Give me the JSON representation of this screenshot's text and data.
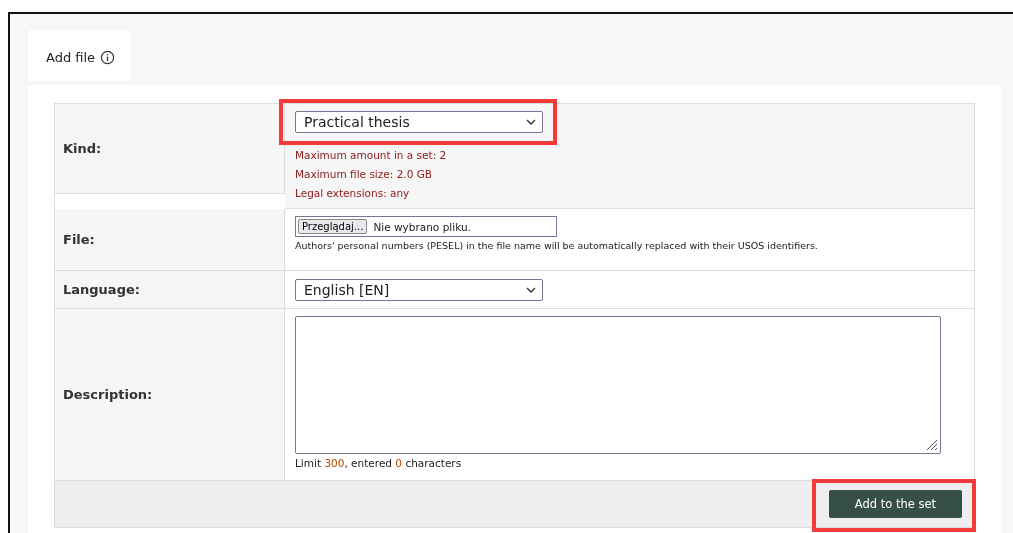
{
  "tabs": [
    {
      "label": "Add file",
      "selected": true
    }
  ],
  "form": {
    "kind": {
      "label": "Kind:",
      "value": "Practical thesis",
      "notes": [
        "Maximum amount in a set: 2",
        "Maximum file size: 2.0 GB",
        "Legal extensions: any"
      ]
    },
    "file": {
      "label": "File:",
      "browse_button": "Przeglądaj...",
      "status": "Nie wybrano pliku.",
      "hint": "Authors' personal numbers (PESEL) in the file name will be automatically replaced with their USOS identifiers."
    },
    "language": {
      "label": "Language:",
      "value": "English [EN]"
    },
    "description": {
      "label": "Description:",
      "limit_prefix": "Limit",
      "limit": "300",
      "entered_prefix": ", entered",
      "entered": "0",
      "suffix": "characters"
    },
    "submit_button": "Add to the set"
  }
}
